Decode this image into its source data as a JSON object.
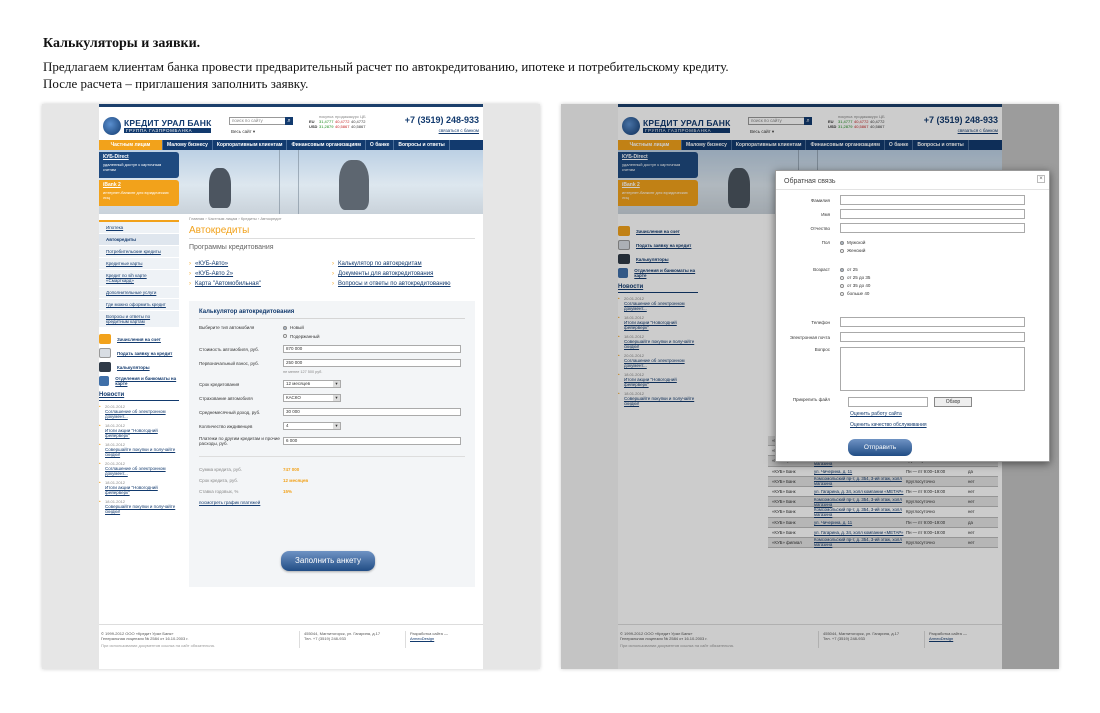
{
  "intro": {
    "title": "Калькуляторы и заявки.",
    "line1": "Предлагаем клиентам банка провести предварительный расчет по автокредитованию, ипотеке и потребительскому кредиту.",
    "line2": "После расчета – приглашения заполнить заявку."
  },
  "site": {
    "logo_name": "КРЕДИТ УРАЛ БАНК",
    "logo_sub": "ГРУППА ГАЗПРОМБАНКА",
    "search_placeholder": "поиск по сайту",
    "all_site": "Весь сайт ▾",
    "rates": {
      "headers": [
        "покупка",
        "продажа",
        "курс ЦБ"
      ],
      "eu": {
        "code": "EU",
        "buy": "31,4777",
        "sell": "40,4772",
        "cb": "40,4772"
      },
      "usd": {
        "code": "USD",
        "buy": "31,2879",
        "sell": "40,5867",
        "cb": "40,5867"
      }
    },
    "phone": "+7 (3519) 248-933",
    "contact": "связаться с банком",
    "nav": [
      "Частным лицам",
      "Малому бизнесу",
      "Корпоративным клиентам",
      "Финансовым организациям",
      "О банке",
      "Вопросы и ответы"
    ],
    "banner": {
      "card1_title": "КУБ-Direct",
      "card1_text": "удаленный доступ к карточным счетам",
      "card2_title": "iBank 2",
      "card2_text": "интернет-банкинг для юридических лиц"
    },
    "menu": [
      "Ипотека",
      "Автокредиты",
      "Потребительские кредиты",
      "Кредитные карты",
      "Кредит по sih карте «Смарткард»",
      "Дополнительные услуги",
      "Где можно оформить кредит",
      "Вопросы и ответы по кредитным картам"
    ],
    "services": [
      "Зачисления на счет",
      "Подать заявку на кредит",
      "Калькуляторы",
      "Отделения и банкоматы на карте"
    ],
    "news": {
      "title": "Новости",
      "items": [
        {
          "date": "20.01.2012",
          "text": "Соглашение об электронном документ..."
        },
        {
          "date": "18.01.2012",
          "text": "Итоги акции \"Новогодний фейерверк\""
        },
        {
          "date": "18.01.2012",
          "text": "Совершайте покупки и получайте скидки!"
        },
        {
          "date": "20.01.2012",
          "text": "Соглашение об электронном документ..."
        },
        {
          "date": "18.01.2012",
          "text": "Итоги акции \"Новогодний фейерверк\""
        },
        {
          "date": "18.01.2012",
          "text": "Совершайте покупки и получайте скидки!"
        }
      ]
    },
    "breadcrumb": "Главная › Частным лицам › Кредиты › Автокредит",
    "page_title": "Автокредиты",
    "programs_title": "Программы кредитования",
    "programs_left": [
      "«КУБ-Авто»",
      "«КУБ-Авто 2»",
      "Карта \"Автомобильная\""
    ],
    "programs_right": [
      "Калькулятор по автокредитам",
      "Документы для автокредитования",
      "Вопросы и ответы по автокредитованию"
    ],
    "calc": {
      "title": "Калькулятор автокредитования",
      "car_type_label": "Выберите тип автомобиля",
      "car_new": "Новый",
      "car_used": "Подержанный",
      "cost_label": "Стоимость автомобиля, руб.",
      "cost_value": "870 000",
      "down_label": "Первоначальный взнос, руб.",
      "down_value": "250 000",
      "down_hint": "не менее 127 500 руб.",
      "term_label": "Срок кредитования",
      "term_value": "12 месяцев",
      "insurance_label": "Страхование автомобиля",
      "insurance_value": "КАСКО",
      "income_label": "Среднемесячный доход, руб.",
      "income_value": "30 000",
      "dependents_label": "Колличество иждивенцев",
      "dependents_value": "4",
      "other_label": "Платежи по другим кредитам и прочие расходы, руб.",
      "other_value": "6 000",
      "sum_label": "Сумма кредита, руб.",
      "sum_value": "747 000",
      "term2_label": "Срок кредита, руб.",
      "term2_value": "12 месяцев",
      "rate_label": "Ставка годовых, %",
      "rate_value": "15%",
      "schedule": "посмотреть график платежей",
      "button": "Заполнить анкету"
    },
    "footer": {
      "copy": "© 1999-2012 ООО «Кредит Урал Банк»",
      "license": "Генеральная лицензия № 2584 от 16.10.2003 г.",
      "note": "При использовании документов ссылка на сайт обязательна.",
      "address": "455044, Магнитогорск, ул. Гагарина, д.17",
      "tel": "Тел. +7 (3519) 248-933",
      "dev": "Разработка сайта —",
      "dev_link": "ArmeoDesign"
    }
  },
  "modal": {
    "title": "Обратная связь",
    "close": "×",
    "surname": "Фамилия",
    "name": "Имя",
    "patronymic": "Отчество",
    "gender": "Пол",
    "male": "Мужской",
    "female": "Женский",
    "age": "Возраст",
    "ages": [
      "от 25",
      "от 25 до 35",
      "от 35 до 40",
      "больше 40"
    ],
    "phone": "Телефон",
    "email": "Электронная почта",
    "question": "Вопрос",
    "attach": "Прикрепить файл",
    "browse": "Обзор",
    "rate_site": "Оценить работу сайта",
    "rate_service": "Оценить качество обслуживания",
    "submit": "Отправить"
  },
  "table_rows": [
    {
      "a": "«КУБ» филиал",
      "b": "Комсомольский пр-т, д. 354, 3-ий этаж, холл магазина",
      "c": "Круглосуточно",
      "d": "нет"
    },
    {
      "a": "«КУБ» Банк",
      "b": "ул. Гагарина, д. 34, холл компании «МЕТАР»",
      "c": "Пн — пт 9:00–19:00",
      "d": "нет"
    },
    {
      "a": "«КУБ» филиал",
      "b": "Комсомольский пр-т, д. 354, 3-ий этаж, холл магазина",
      "c": "Круглосуточно",
      "d": "нет"
    },
    {
      "a": "«КУБ» Банк",
      "b": "ул. Чичерина, д. 11",
      "c": "Пн — пт 9:00–19:00",
      "d": "да"
    },
    {
      "a": "«КУБ» Банк",
      "b": "Комсомольский пр-т, д. 354, 3-ий этаж, холл магазина",
      "c": "Круглосуточно",
      "d": "нет"
    },
    {
      "a": "«КУБ» Банк",
      "b": "ул. Гагарина, д. 34, холл компании «МЕТАР»",
      "c": "Пн — пт 9:00–19:00",
      "d": "нет"
    },
    {
      "a": "«КУБ» Банк",
      "b": "Комсомольский пр-т, д. 354, 3-ий этаж, холл магазина",
      "c": "Круглосуточно",
      "d": "нет"
    },
    {
      "a": "«КУБ» Банк",
      "b": "Комсомольский пр-т, д. 354, 3-ий этаж, холл магазина",
      "c": "Круглосуточно",
      "d": "нет"
    },
    {
      "a": "«КУБ» Банк",
      "b": "ул. Чичерина, д. 11",
      "c": "Пн — пт 9:00–19:00",
      "d": "да"
    },
    {
      "a": "«КУБ» Банк",
      "b": "ул. Гагарина, д. 34, холл компании «МЕТАР»",
      "c": "Пн — пт 9:00–19:00",
      "d": "нет"
    },
    {
      "a": "«КУБ» филиал",
      "b": "Комсомольский пр-т, д. 354, 3-ий этаж, холл магазина",
      "c": "Круглосуточно",
      "d": "нет"
    }
  ]
}
